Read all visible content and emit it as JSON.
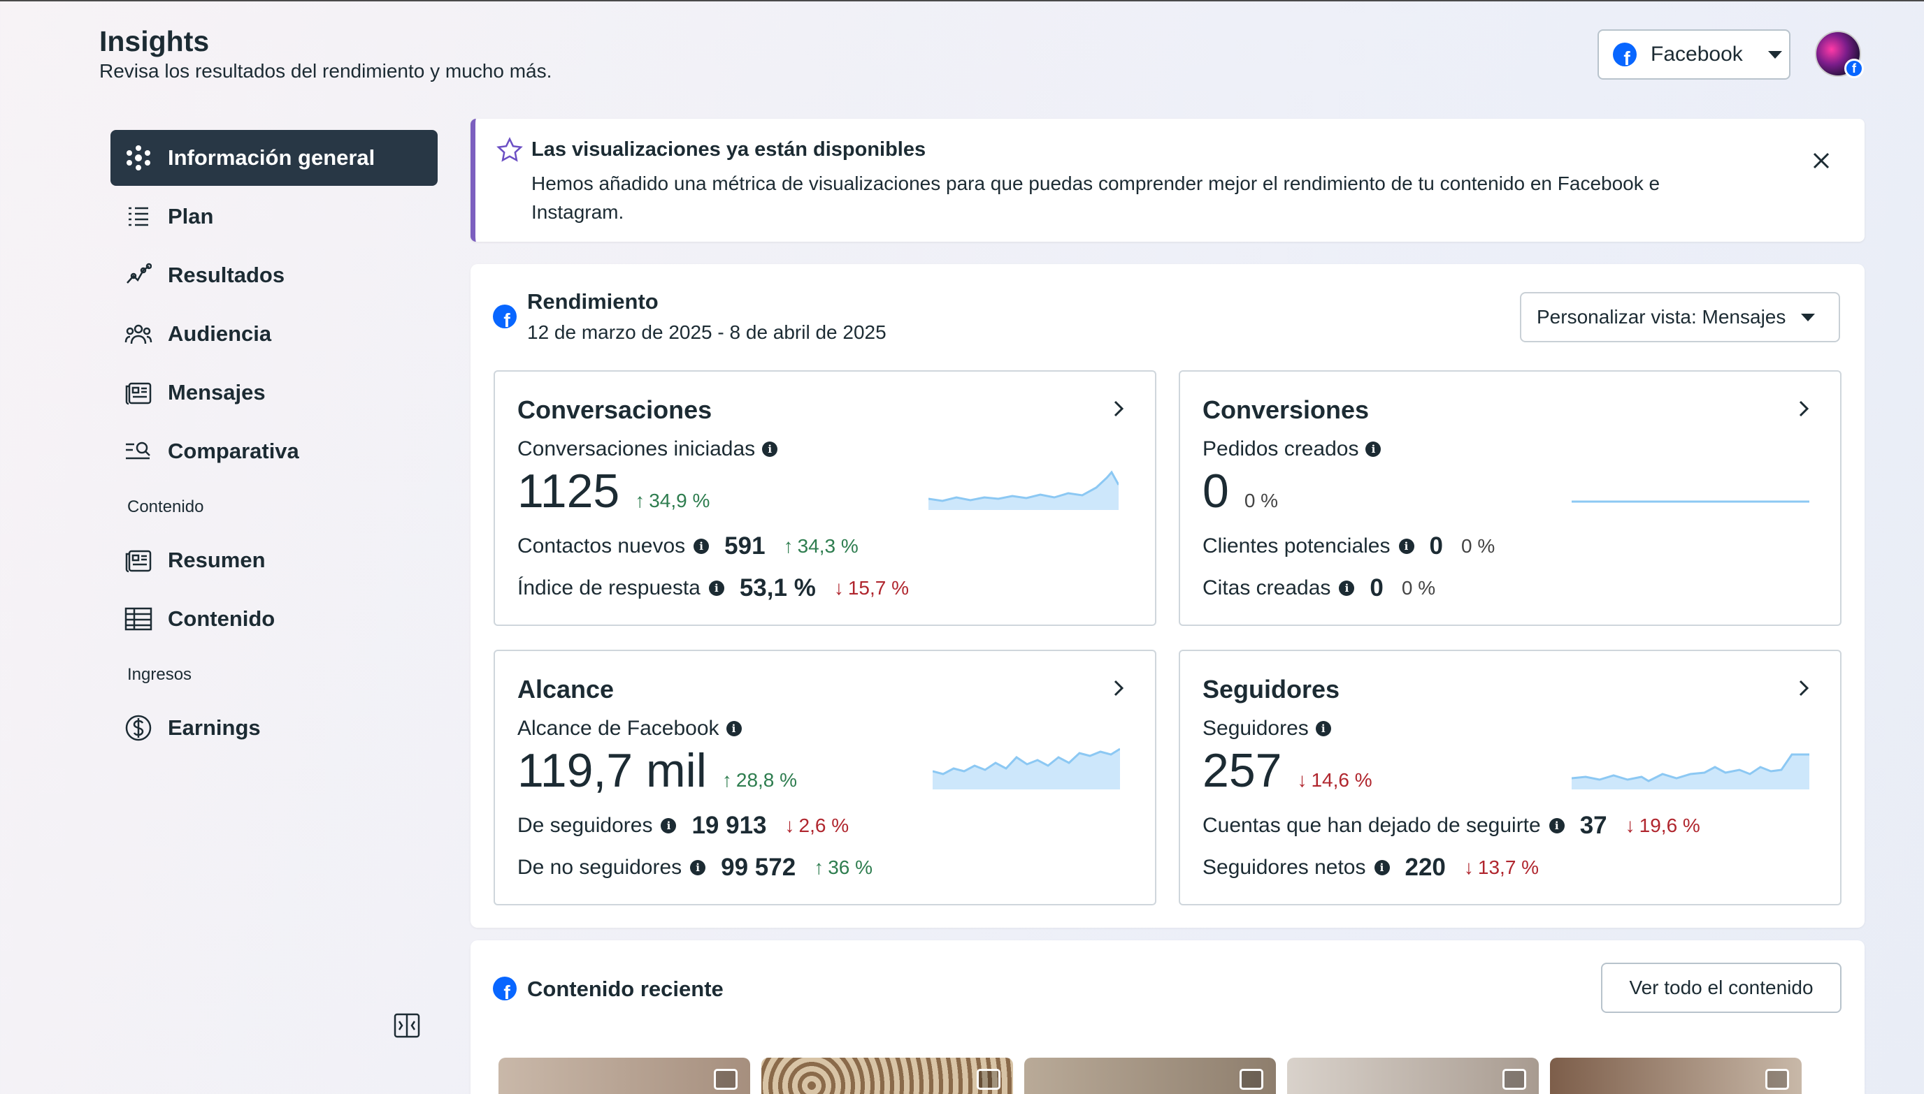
{
  "header": {
    "title": "Insights",
    "subtitle": "Revisa los resultados del rendimiento y mucho más.",
    "platform": "Facebook"
  },
  "sidebar": {
    "items": [
      {
        "label": "Información general",
        "icon": "overview-icon",
        "active": true
      },
      {
        "label": "Plan",
        "icon": "list-icon"
      },
      {
        "label": "Resultados",
        "icon": "trend-icon"
      },
      {
        "label": "Audiencia",
        "icon": "people-icon"
      },
      {
        "label": "Mensajes",
        "icon": "messages-icon"
      },
      {
        "label": "Comparativa",
        "icon": "compare-icon"
      }
    ],
    "section_content": "Contenido",
    "content_items": [
      {
        "label": "Resumen",
        "icon": "summary-icon"
      },
      {
        "label": "Contenido",
        "icon": "table-icon"
      }
    ],
    "section_income": "Ingresos",
    "income_items": [
      {
        "label": "Earnings",
        "icon": "dollar-icon"
      }
    ]
  },
  "banner": {
    "title": "Las visualizaciones ya están disponibles",
    "text": "Hemos añadido una métrica de visualizaciones para que puedas comprender mejor el rendimiento de tu contenido en Facebook e Instagram."
  },
  "performance": {
    "title": "Rendimiento",
    "date_range": "12 de marzo de 2025 - 8 de abril de 2025",
    "view_select": "Personalizar vista: Mensajes",
    "cards": {
      "conversations": {
        "title": "Conversaciones",
        "main_label": "Conversaciones iniciadas",
        "main_value": "1125",
        "main_delta": "34,9 %",
        "row1_label": "Contactos nuevos",
        "row1_value": "591",
        "row1_delta": "34,3 %",
        "row2_label": "Índice de respuesta",
        "row2_value": "53,1 %",
        "row2_delta": "15,7 %"
      },
      "conversions": {
        "title": "Conversiones",
        "main_label": "Pedidos creados",
        "main_value": "0",
        "main_delta": "0 %",
        "row1_label": "Clientes potenciales",
        "row1_value": "0",
        "row1_delta": "0 %",
        "row2_label": "Citas creadas",
        "row2_value": "0",
        "row2_delta": "0 %"
      },
      "reach": {
        "title": "Alcance",
        "main_label": "Alcance de Facebook",
        "main_value": "119,7 mil",
        "main_delta": "28,8 %",
        "row1_label": "De seguidores",
        "row1_value": "19 913",
        "row1_delta": "2,6 %",
        "row2_label": "De no seguidores",
        "row2_value": "99 572",
        "row2_delta": "36 %"
      },
      "followers": {
        "title": "Seguidores",
        "main_label": "Seguidores",
        "main_value": "257",
        "main_delta": "14,6 %",
        "row1_label": "Cuentas que han dejado de seguirte",
        "row1_value": "37",
        "row1_delta": "19,6 %",
        "row2_label": "Seguidores netos",
        "row2_value": "220",
        "row2_delta": "13,7 %"
      }
    }
  },
  "recent": {
    "title": "Contenido reciente",
    "button": "Ver todo el contenido"
  },
  "colors": {
    "accent": "#0866ff",
    "active_nav": "#283745",
    "banner_border": "#7c5fbf",
    "up": "#2e7d4f",
    "down": "#b0262e",
    "spark": "#9fd0f5"
  }
}
